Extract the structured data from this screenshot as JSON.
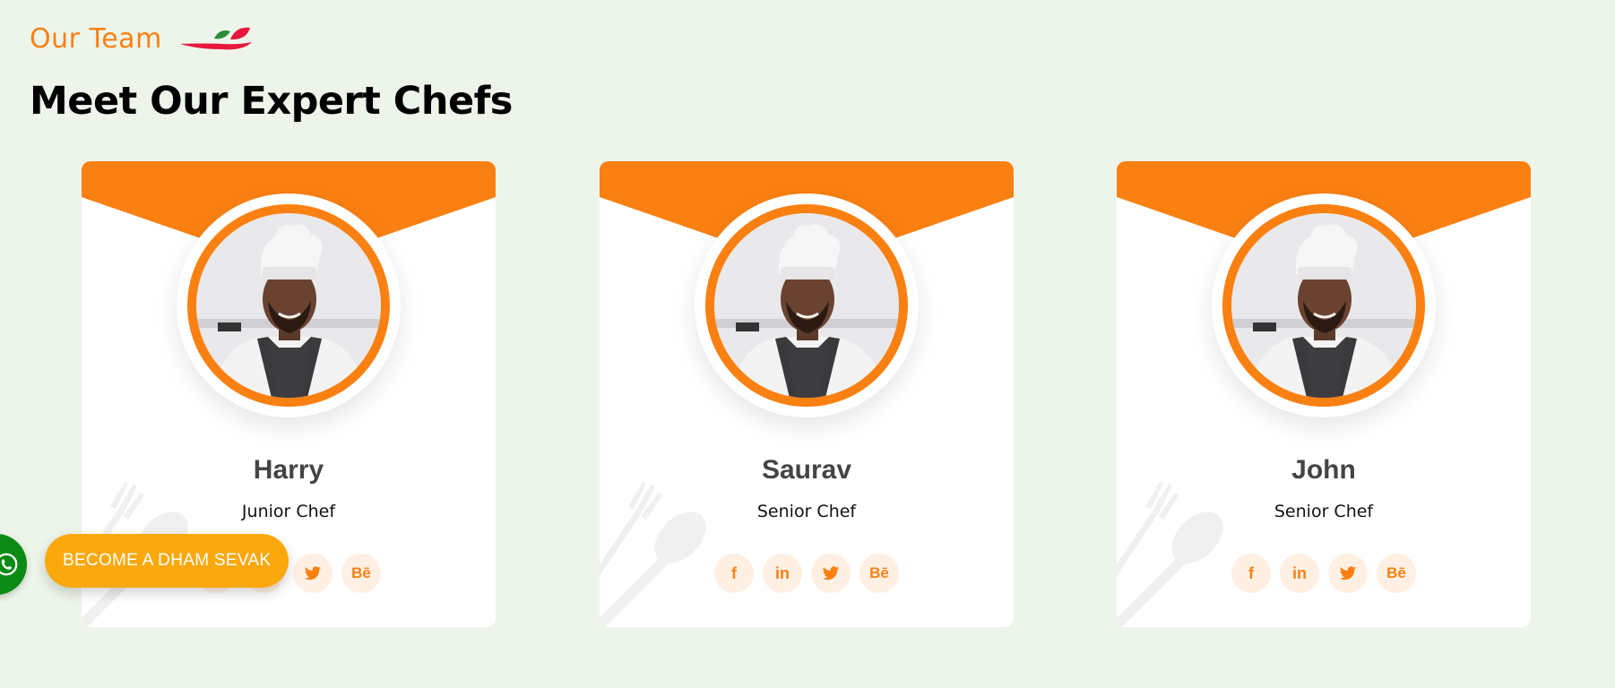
{
  "section": {
    "eyebrow": "Our Team",
    "eyebrow_icon": "plate-leaf-icon",
    "heading": "Meet Our Expert Chefs"
  },
  "colors": {
    "accent": "#fb8012",
    "background": "#edf5ea",
    "card": "#ffffff",
    "social_bg": "#fff0e3",
    "cta": "#fba80d",
    "whatsapp": "#0a8a13"
  },
  "chefs": [
    {
      "name": "Harry",
      "role": "Junior Chef"
    },
    {
      "name": "Saurav",
      "role": "Senior Chef"
    },
    {
      "name": "John",
      "role": "Senior Chef"
    }
  ],
  "socials": [
    {
      "icon": "facebook-icon",
      "label": "f"
    },
    {
      "icon": "linkedin-icon",
      "label": "in"
    },
    {
      "icon": "twitter-icon",
      "label": ""
    },
    {
      "icon": "behance-icon",
      "label": "Bē"
    }
  ],
  "floating": {
    "cta_label": "BECOME A DHAM SEVAK",
    "whatsapp_icon": "whatsapp-icon"
  }
}
